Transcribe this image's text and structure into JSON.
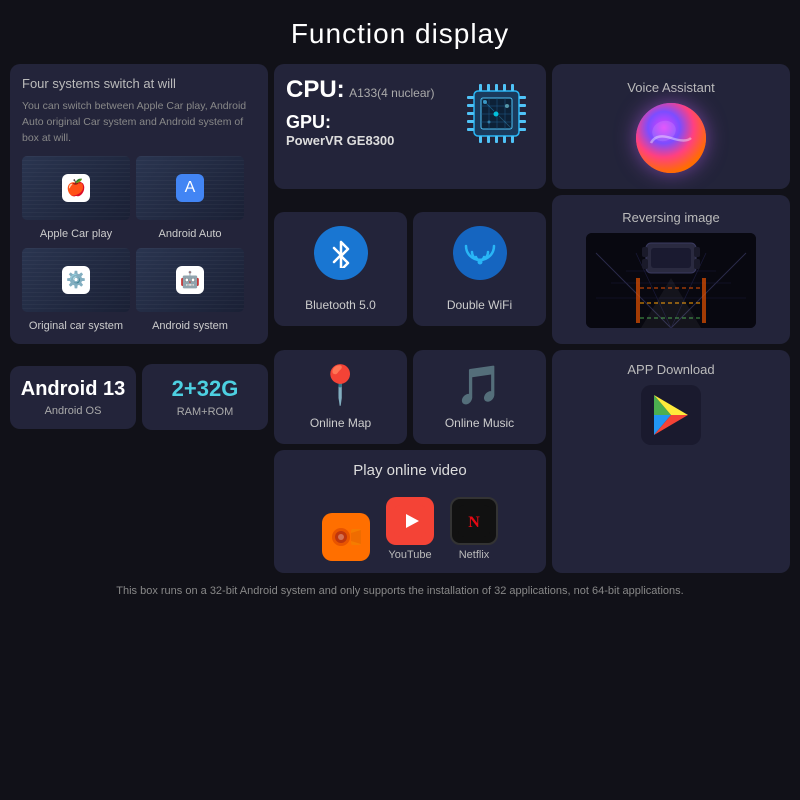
{
  "page": {
    "title": "Function display",
    "footer": "This box runs on a 32-bit Android system and only supports the installation of 32 applications, not 64-bit applications."
  },
  "four_systems": {
    "title": "Four systems switch at will",
    "desc": "You can switch between Apple Car play, Android Auto original Car system and Android system of box at will.",
    "items": [
      {
        "label": "Apple Car play",
        "icon": "🍎"
      },
      {
        "label": "Android Auto",
        "icon": "A"
      },
      {
        "label": "Original car system",
        "icon": "⚙"
      },
      {
        "label": "Android system",
        "icon": "🤖"
      }
    ]
  },
  "cpu": {
    "cpu_label": "CPU:",
    "cpu_model": "A133(4 nuclear)",
    "gpu_label": "GPU:",
    "gpu_model": "PowerVR GE8300"
  },
  "voice": {
    "label": "Voice Assistant"
  },
  "bluetooth": {
    "label": "Bluetooth 5.0"
  },
  "wifi": {
    "label": "Double WiFi"
  },
  "reversing": {
    "label": "Reversing image"
  },
  "online_map": {
    "label": "Online Map"
  },
  "online_music": {
    "label": "Online Music"
  },
  "android_os": {
    "version": "Android 13",
    "sub": "Android OS"
  },
  "ram_rom": {
    "value": "2+32G",
    "sub": "RAM+ROM"
  },
  "video": {
    "title": "Play online video",
    "apps": [
      {
        "name": "",
        "icon_type": "camera"
      },
      {
        "name": "YouTube",
        "icon_type": "youtube"
      },
      {
        "name": "Netflix",
        "icon_type": "netflix"
      }
    ]
  },
  "app_download": {
    "label": "APP Download"
  }
}
